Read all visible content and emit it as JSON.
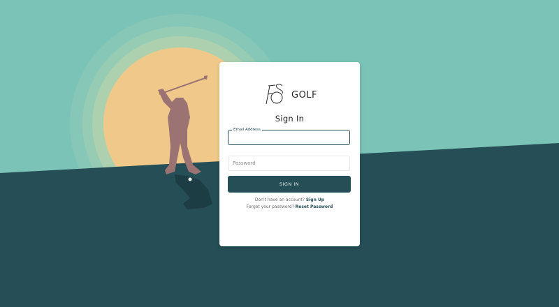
{
  "colors": {
    "sky": "#7ac3b6",
    "ground": "#264e57",
    "sun": "#f0c98a",
    "golfer": "#9c7373",
    "button": "#264e57"
  },
  "brand": {
    "logo_icon": "fs-monogram-icon",
    "name": "GOLF"
  },
  "form": {
    "title": "Sign In",
    "email": {
      "label": "Email Address",
      "value": ""
    },
    "password": {
      "placeholder": "Password",
      "value": ""
    },
    "submit_label": "SIGN IN"
  },
  "footer": {
    "signup_prompt": "Don't have an account?",
    "signup_link": "Sign Up",
    "reset_prompt": "Forgot your password?",
    "reset_link": "Reset Password"
  }
}
